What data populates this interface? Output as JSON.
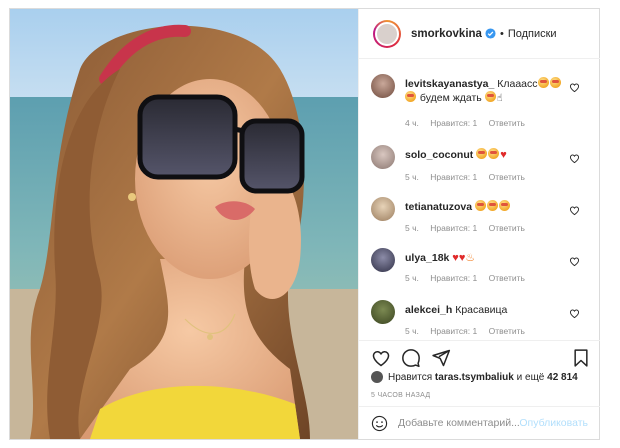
{
  "post": {
    "username": "smorkovkina",
    "follow_label": "Подписки",
    "verified_icon": "verified-badge-icon"
  },
  "comments": [
    {
      "user": "levitskayanastya_",
      "text": "Клааасс",
      "tail": "будем ждать",
      "time": "4 ч.",
      "likes": "Нравится: 1",
      "reply": "Ответить"
    },
    {
      "user": "solo_coconut",
      "text": "",
      "time": "5 ч.",
      "likes": "Нравится: 1",
      "reply": "Ответить"
    },
    {
      "user": "tetianatuzova",
      "text": "",
      "time": "5 ч.",
      "likes": "Нравится: 1",
      "reply": "Ответить"
    },
    {
      "user": "ulya_18k",
      "text": "",
      "time": "5 ч.",
      "likes": "Нравится: 1",
      "reply": "Ответить"
    },
    {
      "user": "alekcei_h",
      "text": "Красавица",
      "time": "5 ч.",
      "likes": "Нравится: 1",
      "reply": "Ответить"
    }
  ],
  "likes": {
    "prefix": "Нравится",
    "user": "taras.tsymbaliuk",
    "middle": "и ещё",
    "count": "42 814"
  },
  "time_ago": "5 ЧАСОВ НАЗАД",
  "add_comment": {
    "placeholder": "Добавьте комментарий...",
    "publish": "Опубликовать"
  },
  "colors": {
    "accent": "#0095f6",
    "publish_disabled": "#b2dffc",
    "muted": "#8e8e8e",
    "border": "#dbdbdb"
  }
}
